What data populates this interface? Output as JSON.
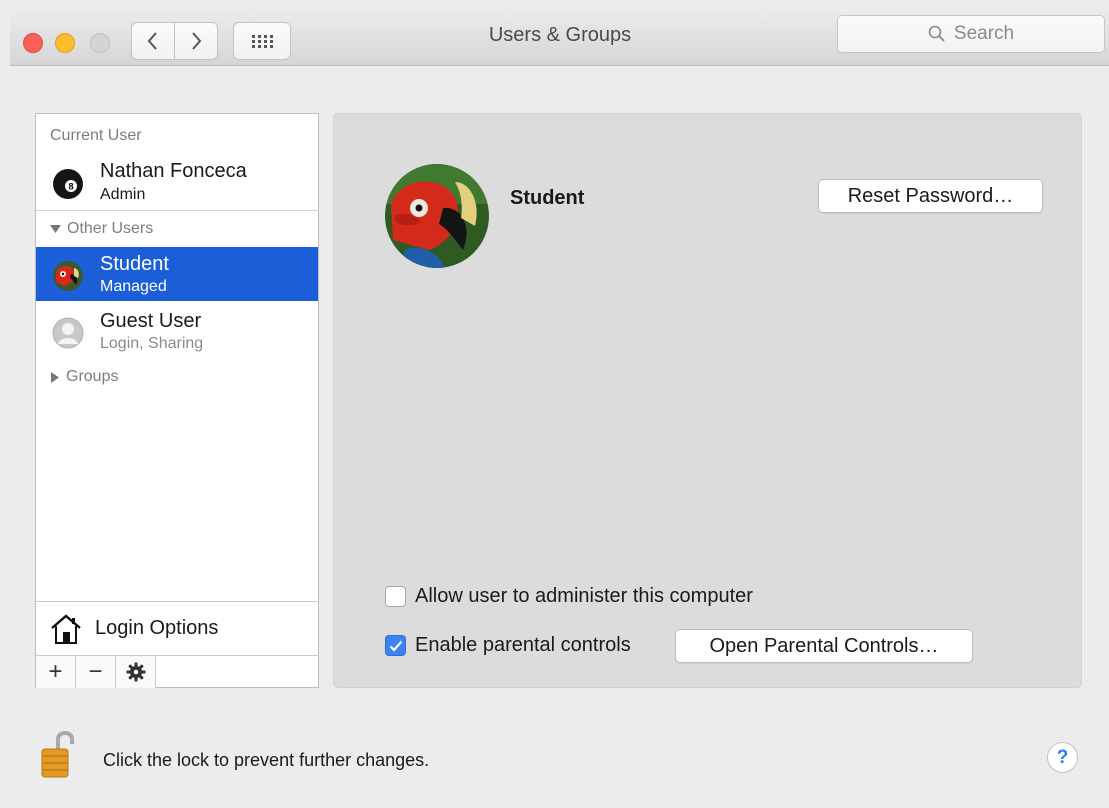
{
  "window": {
    "title": "Users & Groups",
    "search_placeholder": "Search",
    "nav_back_icon": "chevron-left-icon",
    "nav_forward_icon": "chevron-right-icon",
    "grid_icon": "show-all-grid-icon"
  },
  "sidebar": {
    "current_user_header": "Current User",
    "current_user": {
      "name": "Nathan Fonceca",
      "role": "Admin",
      "avatar_icon": "8-ball-avatar-icon"
    },
    "other_users_header": "Other Users",
    "other_users": [
      {
        "name": "Student",
        "role": "Managed",
        "avatar_icon": "parrot-avatar-icon",
        "selected": true
      },
      {
        "name": "Guest User",
        "role": "Login, Sharing",
        "avatar_icon": "guest-avatar-icon",
        "selected": false
      }
    ],
    "groups_header": "Groups",
    "login_options_label": "Login Options",
    "add_label": "+",
    "remove_label": "−"
  },
  "detail": {
    "user_name": "Student",
    "reset_password_label": "Reset Password…",
    "allow_admin_label": "Allow user to administer this computer",
    "allow_admin_checked": false,
    "parental_controls_label": "Enable parental controls",
    "parental_controls_checked": true,
    "open_parental_controls_label": "Open Parental Controls…"
  },
  "footer": {
    "lock_text": "Click the lock to prevent further changes.",
    "help_label": "?"
  },
  "colors": {
    "selection": "#1b5ed7",
    "checkbox_on": "#3b82f6",
    "close": "#fc5f57",
    "minimize": "#fdbc2e"
  }
}
